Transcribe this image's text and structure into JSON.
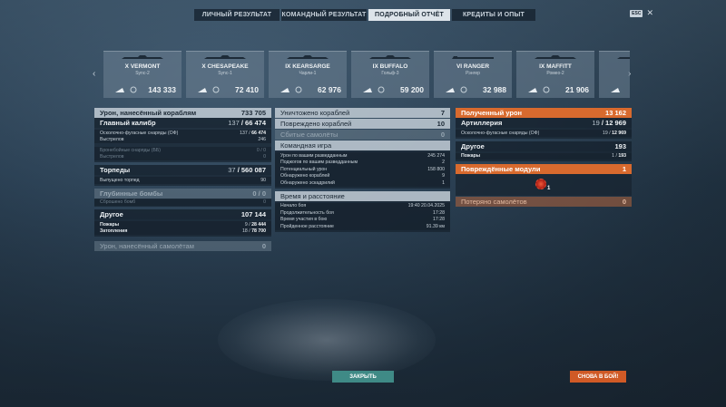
{
  "tabs": [
    {
      "label": "ЛИЧНЫЙ РЕЗУЛЬТАТ",
      "active": false
    },
    {
      "label": "КОМАНДНЫЙ РЕЗУЛЬТАТ",
      "active": false
    },
    {
      "label": "ПОДРОБНЫЙ ОТЧЁТ",
      "active": true
    },
    {
      "label": "КРЕДИТЫ И ОПЫТ",
      "active": false
    }
  ],
  "hotkey": "ESC",
  "ships": [
    {
      "tier_name": "X VERMONT",
      "player": "Sync-2",
      "damage": "143 333"
    },
    {
      "tier_name": "X CHESAPEAKE",
      "player": "Sync-1",
      "damage": "72 410"
    },
    {
      "tier_name": "IX KEARSARGE",
      "player": "Чарли-1",
      "damage": "62 976"
    },
    {
      "tier_name": "IX BUFFALO",
      "player": "Гольф-3",
      "damage": "59 200"
    },
    {
      "tier_name": "VI RANGER",
      "player": "Рэнгер",
      "damage": "32 988"
    },
    {
      "tier_name": "IX MAFFITT",
      "player": "Ромео-2",
      "damage": "21 906"
    }
  ],
  "damage_panel": {
    "title": "Урон, нанесённый кораблям",
    "total": "733 705",
    "main_battery": {
      "label": "Главный калибр",
      "hits": "137",
      "total": "66 474"
    },
    "he_shells": {
      "label": "Осколочно-фугасные снаряды (ОФ)",
      "hits": "137",
      "total": "66 474"
    },
    "shots": {
      "label": "Выстрелов",
      "value": "246"
    },
    "ap_shells": {
      "label": "Бронебойные снаряды (ББ)",
      "value": "0 / 0"
    },
    "ap_shots": {
      "label": "Выстрелов",
      "value": "0"
    },
    "torpedoes": {
      "label": "Торпеды",
      "hits": "37",
      "total": "560 087"
    },
    "torp_launched": {
      "label": "Выпущено торпед",
      "value": "90"
    },
    "depth_charges": {
      "label": "Глубинные бомбы",
      "value": "0 / 0"
    },
    "bombs_dropped": {
      "label": "Сброшено бомб",
      "value": "0"
    },
    "other": {
      "label": "Другое",
      "total": "107 144"
    },
    "fires": {
      "label": "Пожары",
      "hits": "9",
      "total": "28 444"
    },
    "floods": {
      "label": "Затопления",
      "hits": "18",
      "total": "78 700"
    },
    "planes_damage": {
      "label": "Урон, нанесённый самолётам",
      "value": "0"
    }
  },
  "middle_panel": {
    "ships_destroyed": {
      "label": "Уничтожено кораблей",
      "value": "7"
    },
    "ships_damaged": {
      "label": "Повреждено кораблей",
      "value": "10"
    },
    "planes_shot": {
      "label": "Сбитые самолёты",
      "value": "0"
    },
    "team_game": "Командная игра",
    "spotting_damage": {
      "label": "Урон по вашим разведданным",
      "value": "245 274"
    },
    "spotting_fires": {
      "label": "Поджогов по вашим разведданным",
      "value": "2"
    },
    "potential_damage": {
      "label": "Потенциальный урон",
      "value": "158 800"
    },
    "ships_spotted": {
      "label": "Обнаружено кораблей",
      "value": "9"
    },
    "squadrons_spotted": {
      "label": "Обнаружено эскадрилий",
      "value": "1"
    },
    "time_distance": "Время и расстояние",
    "battle_start": {
      "label": "Начало боя",
      "value": "19:40  20.04.2025"
    },
    "battle_duration": {
      "label": "Продолжительность боя",
      "value": "17:28"
    },
    "time_in_battle": {
      "label": "Время участия в бою",
      "value": "17:28"
    },
    "distance": {
      "label": "Пройденное расстояние",
      "value": "91.39 км"
    }
  },
  "received_panel": {
    "received": {
      "label": "Полученный урон",
      "value": "13 162"
    },
    "artillery": {
      "label": "Артиллерия",
      "hits": "19",
      "total": "12 969"
    },
    "he_shells": {
      "label": "Осколочно-фугасные снаряды (ОФ)",
      "hits": "19",
      "total": "12 969"
    },
    "other": {
      "label": "Другое",
      "value": "193"
    },
    "fires": {
      "label": "Пожары",
      "hits": "1",
      "total": "193"
    },
    "modules": {
      "label": "Повреждённые модули",
      "value": "1"
    },
    "module_count": "1",
    "planes_lost": {
      "label": "Потеряно самолётов",
      "value": "0"
    }
  },
  "buttons": {
    "close": "ЗАКРЫТЬ",
    "battle": "СНОВА В БОЙ!"
  },
  "colors": {
    "accent_orange": "#d86a2e",
    "close_teal": "#3f8a86"
  }
}
